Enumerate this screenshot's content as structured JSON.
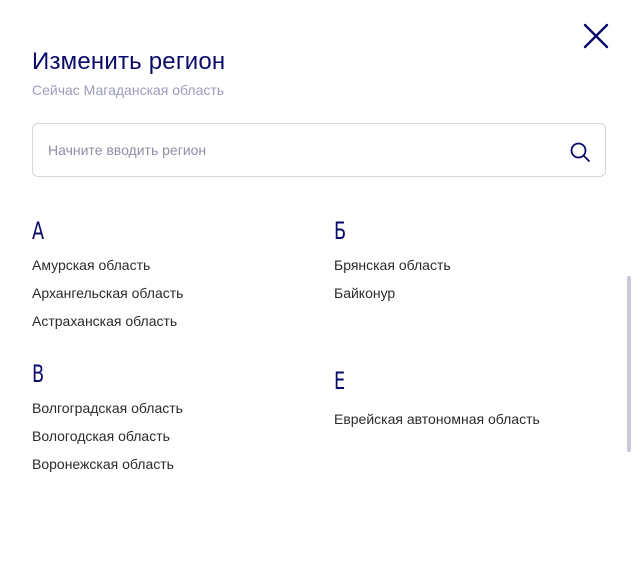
{
  "modal": {
    "title": "Изменить регион",
    "subtitle": "Сейчас Магаданская область",
    "close_icon": "close-icon",
    "accent_color": "#0a0a6b"
  },
  "search": {
    "placeholder": "Начните вводить регион",
    "value": "",
    "icon": "search-icon"
  },
  "groups": [
    {
      "letter": "А",
      "regions": [
        "Амурская область",
        "Архангельская область",
        "Астраханская область"
      ]
    },
    {
      "letter": "Б",
      "regions": [
        "Брянская область",
        "Байконур"
      ]
    },
    {
      "letter": "В",
      "regions": [
        "Волгоградская область",
        "Вологодская область",
        "Воронежская область"
      ]
    },
    {
      "letter": "Е",
      "regions": [
        "Еврейская автономная область"
      ]
    }
  ]
}
